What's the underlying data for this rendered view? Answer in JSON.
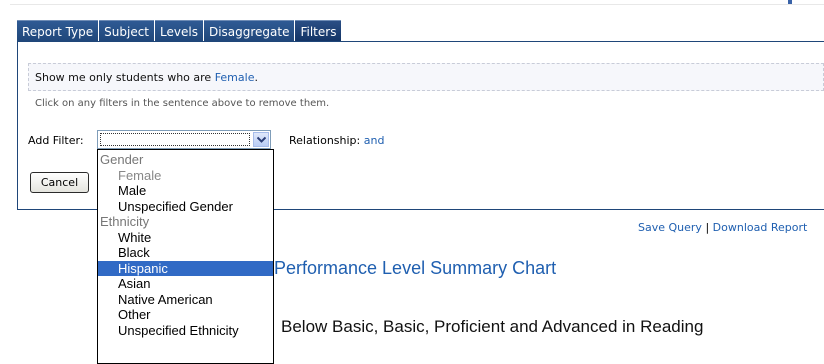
{
  "tabs": [
    "Report Type",
    "Subject",
    "Levels",
    "Disaggregate",
    "Filters"
  ],
  "filter_sentence": {
    "prefix": "Show me only students who are ",
    "value": "Female",
    "suffix": "."
  },
  "hint": "Click on any filters in the sentence above to remove them.",
  "add_filter": {
    "label": "Add Filter:",
    "value": ""
  },
  "relationship": {
    "label": "Relationship:",
    "value": "and"
  },
  "cancel_label": "Cancel",
  "dropdown_options": [
    {
      "label": "Gender",
      "kind": "group"
    },
    {
      "label": "Female",
      "kind": "disabled"
    },
    {
      "label": "Male",
      "kind": "item"
    },
    {
      "label": "Unspecified Gender",
      "kind": "item"
    },
    {
      "label": "Ethnicity",
      "kind": "group"
    },
    {
      "label": "White",
      "kind": "item"
    },
    {
      "label": "Black",
      "kind": "item"
    },
    {
      "label": "Hispanic",
      "kind": "selected"
    },
    {
      "label": "Asian",
      "kind": "item"
    },
    {
      "label": "Native American",
      "kind": "item"
    },
    {
      "label": "Other",
      "kind": "item"
    },
    {
      "label": "Unspecified Ethnicity",
      "kind": "item"
    }
  ],
  "links": {
    "save_query": "Save Query",
    "separator": "|",
    "download_report": "Download Report"
  },
  "chart_title": "Performance Level Summary Chart",
  "subtitle": "Below Basic, Basic, Proficient and Advanced in Reading",
  "colors": {
    "tab_bg": "#1f4679",
    "link": "#1f5fb0",
    "selected_option": "#316ac5"
  }
}
